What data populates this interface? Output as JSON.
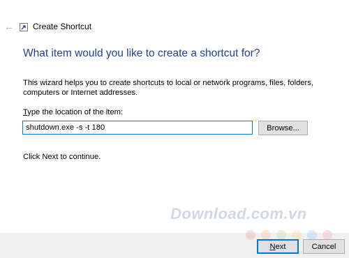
{
  "window": {
    "title": "Create Shortcut",
    "back_glyph": "←"
  },
  "page": {
    "heading": "What item would you like to create a shortcut for?",
    "description": "This wizard helps you to create shortcuts to local or network programs, files, folders, computers or Internet addresses.",
    "location_label_accel": "T",
    "location_label_rest": "ype the location of the item:",
    "location_value": "shutdown.exe -s -t 180",
    "browse_label": "Browse...",
    "hint": "Click Next to continue."
  },
  "footer": {
    "next_accel": "N",
    "next_rest": "ext",
    "cancel_label": "Cancel"
  },
  "watermark": "Download.com.vn",
  "colors": {
    "heading": "#1f3f9a",
    "input_border": "#0078d7",
    "dots": [
      "#f4a3a3",
      "#f7c59f",
      "#b5e3a8",
      "#f9d98b",
      "#9cc8f0",
      "#f0a8c0"
    ]
  }
}
